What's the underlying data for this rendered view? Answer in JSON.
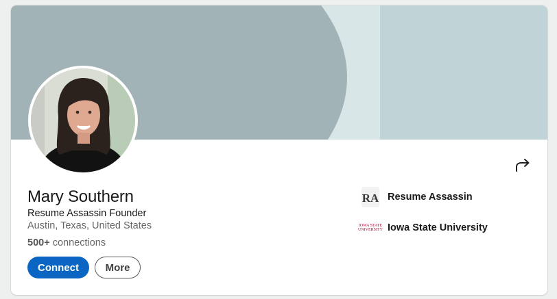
{
  "profile": {
    "name": "Mary Southern",
    "headline": "Resume Assassin Founder",
    "location": "Austin, Texas, United States",
    "connections_count": "500+",
    "connections_label": "connections"
  },
  "actions": {
    "connect_label": "Connect",
    "more_label": "More"
  },
  "organizations": [
    {
      "name": "Resume Assassin",
      "logo_text": "RA",
      "icon": "resume-assassin-logo"
    },
    {
      "name": "Iowa State University",
      "logo_text_line1": "IOWA STATE",
      "logo_text_line2": "UNIVERSITY",
      "icon": "iowa-state-logo"
    }
  ],
  "icons": {
    "share": "share-arrow-icon"
  },
  "colors": {
    "primary": "#0a66c2",
    "banner_dark": "#a1b3b6",
    "banner_light": "#c0d4d8",
    "text": "#191919",
    "muted": "#666666",
    "isu_red": "#b1002a"
  }
}
